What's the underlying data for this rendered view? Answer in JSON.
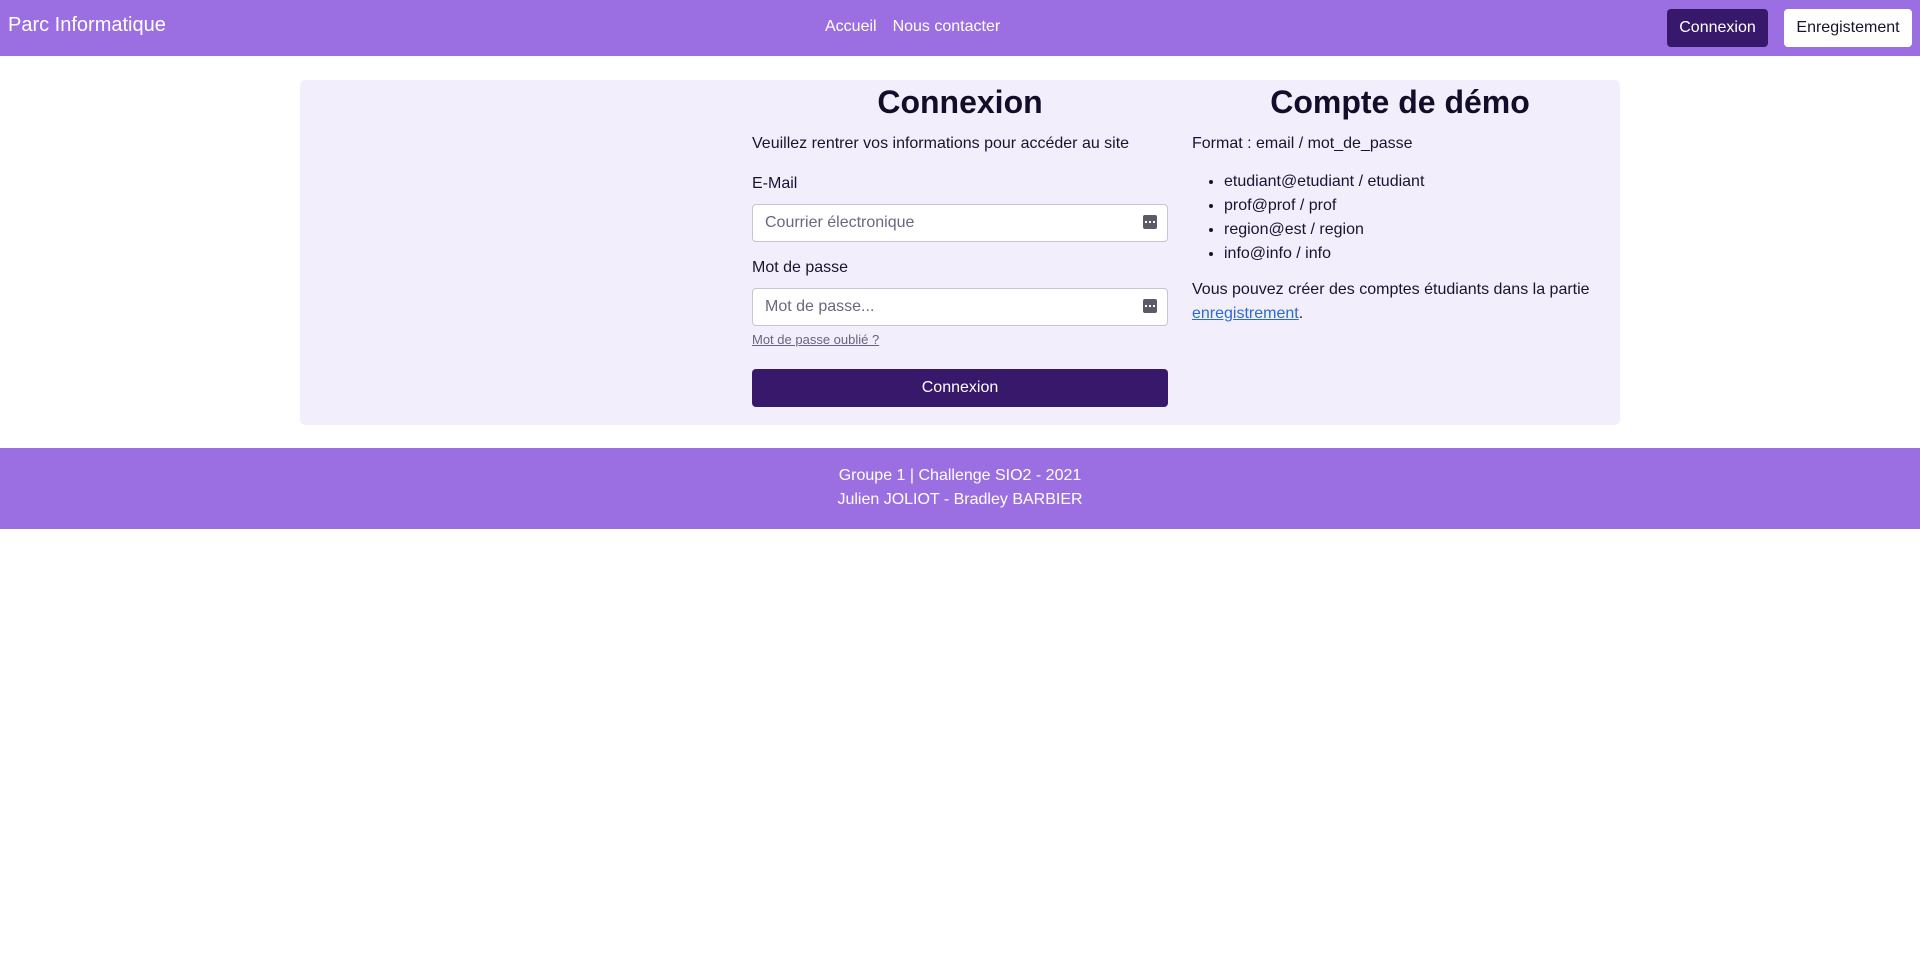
{
  "navbar": {
    "brand": "Parc Informatique",
    "links": [
      "Accueil",
      "Nous contacter"
    ],
    "login_label": "Connexion",
    "register_label": "Enregistement",
    "color": "#9b6fe2"
  },
  "login": {
    "title": "Connexion",
    "intro": "Veuillez rentrer vos informations pour accéder au site",
    "email_label": "E-Mail",
    "email_placeholder": "Courrier électronique",
    "email_value": "",
    "password_label": "Mot de passe",
    "password_placeholder": "Mot de passe...",
    "password_value": "",
    "field_icon": "password-manager-icon",
    "forgot_label": "Mot de passe oublié ?",
    "submit_label": "Connexion",
    "button_color": "#37186a"
  },
  "demo": {
    "title": "Compte de démo",
    "format": "Format : email / mot_de_passe",
    "accounts": [
      "etudiant@etudiant / etudiant",
      "prof@prof / prof",
      "region@est / region",
      "info@info / info"
    ],
    "note_text": "Vous pouvez créer des comptes étudiants dans la partie",
    "note_link": "enregistrement",
    "note_end": "."
  },
  "footer": {
    "line1": "Groupe 1 | Challenge SIO2 - 2021",
    "line2": "Julien JOLIOT - Bradley BARBIER"
  }
}
